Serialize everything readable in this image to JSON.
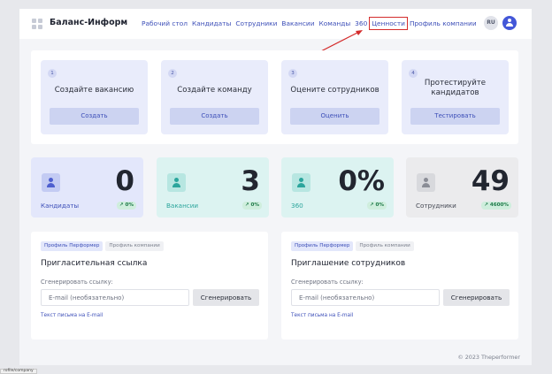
{
  "header": {
    "brand": "Баланс-Информ",
    "nav": [
      "Рабочий стол",
      "Кандидаты",
      "Сотрудники",
      "Вакансии",
      "Команды",
      "360",
      "Ценности",
      "Профиль компании"
    ],
    "active_nav": "Ценности",
    "lang": "RU"
  },
  "steps": [
    {
      "num": "1",
      "title": "Создайте вакансию",
      "button": "Создать"
    },
    {
      "num": "2",
      "title": "Создайте команду",
      "button": "Создать"
    },
    {
      "num": "3",
      "title": "Оцените сотрудников",
      "button": "Оценить"
    },
    {
      "num": "4",
      "title": "Протестируйте кандидатов",
      "button": "Тестировать"
    }
  ],
  "stats": [
    {
      "label": "Кандидаты",
      "value": "0",
      "change": "↗ 0%"
    },
    {
      "label": "Вакансии",
      "value": "3",
      "change": "↗ 0%"
    },
    {
      "label": "360",
      "value": "0%",
      "change": "↗ 0%"
    },
    {
      "label": "Сотрудники",
      "value": "49",
      "change": "↗ 4600%"
    }
  ],
  "invite_link": {
    "tab_active": "Профиль Перформер",
    "tab_inactive": "Профиль компании",
    "title": "Пригласительная ссылка",
    "label": "Сгенерировать ссылку:",
    "placeholder": "E-mail (необязательно)",
    "button": "Сгенерировать",
    "link": "Текст письма на E-mail"
  },
  "invite_staff": {
    "tab_active": "Профиль Перформер",
    "tab_inactive": "Профиль компании",
    "title": "Приглашение сотрудников",
    "label": "Сгенерировать ссылку:",
    "placeholder": "E-mail (необязательно)",
    "button": "Сгенерировать",
    "link": "Текст письма на E-mail"
  },
  "footer": "© 2023 Theperformer",
  "status_chip": "rofile/company",
  "colors": {
    "accent": "#3d4fb8",
    "highlight": "#d42c2c",
    "teal": "#2ba59c",
    "positive": "#1f7a4a"
  }
}
